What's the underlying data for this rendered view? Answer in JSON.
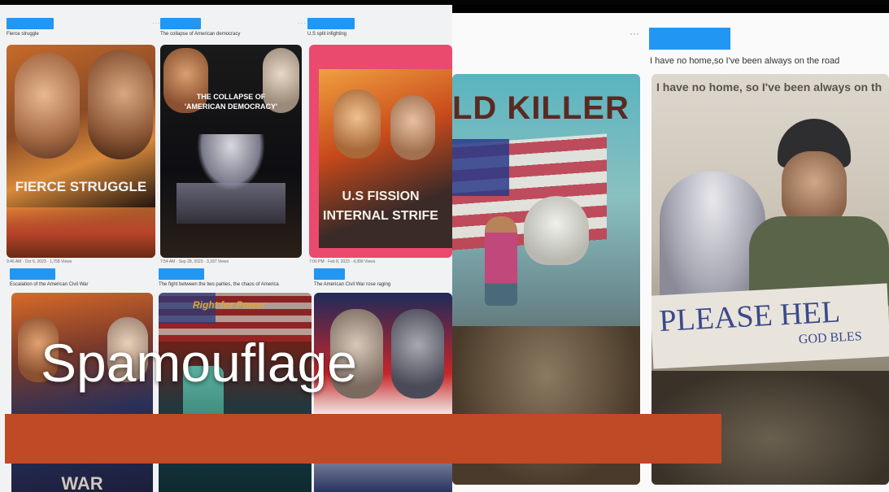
{
  "title": "Spamouflage",
  "colors": {
    "accent_bar": "#bf4a25",
    "name_block": "#2196f3"
  },
  "left_posts": [
    {
      "caption": "Fierce struggle",
      "card_text": "FIERCE STRUGGLE"
    },
    {
      "caption": "The collapse of American democracy",
      "card_text": "THE COLLAPSE OF 'AMERICAN DEMOCRACY'"
    },
    {
      "caption": "U.S split infighting",
      "card_text": "U.S FISSION INTERNAL STRIFE"
    },
    {
      "caption": "Escalation of the American Civil War",
      "card_text": "WAR"
    },
    {
      "caption": "The fight between the two parties, the chaos of America",
      "card_text": "Right for Power"
    },
    {
      "caption": "The American Civil War rose raging",
      "card_text": ""
    }
  ],
  "right_post": {
    "caption": "I have no home,so I've been always on the road",
    "left_card_text": "LD KILLER",
    "right_card_top_text": "I have no home, so I've been always on th",
    "sign_text": "PLEASE HEL",
    "sign_subtext": "GOD BLES"
  },
  "icons": [
    "more-dots-icon"
  ]
}
